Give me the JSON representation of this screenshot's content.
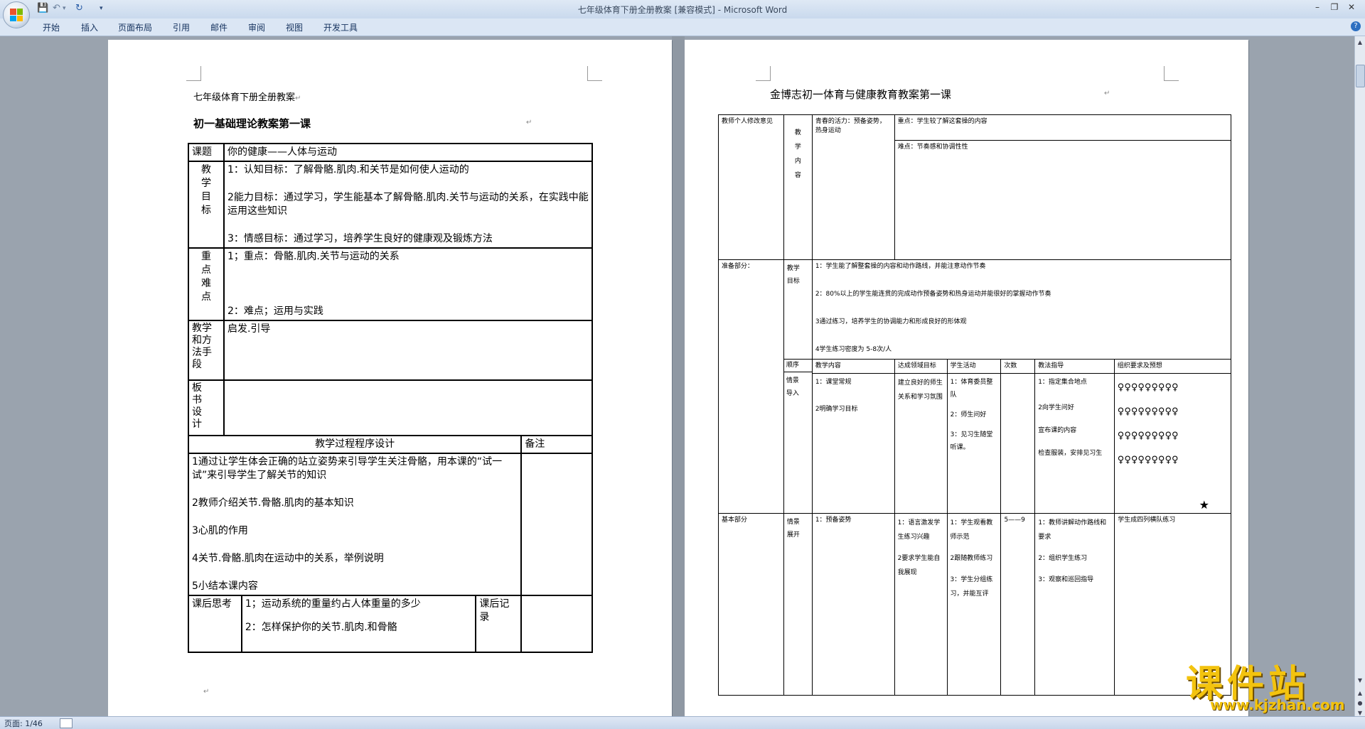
{
  "app": {
    "window_title": "七年级体育下册全册教案 [兼容模式] - Microsoft Word",
    "ribbon_tabs": [
      "开始",
      "插入",
      "页面布局",
      "引用",
      "邮件",
      "审阅",
      "视图",
      "开发工具"
    ],
    "status": {
      "page": "页面: 1/46"
    },
    "help": "?"
  },
  "page1": {
    "header": "七年级体育下册全册教案",
    "title": "初一基础理论教案第一课",
    "table": {
      "topic_label": "课题",
      "topic_value": "你的健康——人体与运动",
      "goals_label": "教学目标",
      "goals": [
        "1：认知目标：了解骨骼.肌肉.和关节是如何使人运动的",
        "2能力目标：通过学习，学生能基本了解骨骼.肌肉.关节与运动的关系，在实践中能运用这些知识",
        "3：情感目标：通过学习，培养学生良好的健康观及锻炼方法"
      ],
      "key_label": "重点难点",
      "key_points": [
        "1；重点：骨骼.肌肉.关节与运动的关系",
        "2：难点；运用与实践"
      ],
      "method_label": "教学和方法手段",
      "method_value": "启发.引导",
      "board_label": "板书设计",
      "process_header": "教学过程程序设计",
      "remark_header": "备注",
      "process_items": [
        "1通过让学生体会正确的站立姿势来引导学生关注骨骼，用本课的“试一试”来引导学生了解关节的知识",
        "2教师介绍关节.骨骼.肌肉的基本知识",
        "3心肌的作用",
        "4关节.骨骼.肌肉在运动中的关系，举例说明",
        "5小结本课内容"
      ],
      "after_label": "课后思考",
      "after_items": [
        "1；运动系统的重量约占人体重量的多少",
        "2：怎样保护你的关节.肌肉.和骨骼"
      ],
      "record_label": "课后记录"
    }
  },
  "page2": {
    "title": "金博志初一体育与健康教育教案第一课",
    "row1": {
      "col1": "教师个人修改意见",
      "col2": "教学内容",
      "col3": "青春的活力：预备姿势，热身运动",
      "key": "重点：学生较了解这套操的内容",
      "difficulty": "难点：节奏感和协调性性"
    },
    "row2": {
      "col1": "准备部分：",
      "goal_label": "教学目标",
      "goals": [
        "1：学生能了解整套操的内容和动作路线，并能注意动作节奏",
        "2：80%以上的学生能连贯的完成动作预备姿势和热身运动并能很好的掌握动作节奏",
        "3通过练习，培养学生的协调能力和形成良好的形体观",
        "4学生练习密度为    5-8次/人"
      ]
    },
    "row3": {
      "headers": [
        "顺序",
        "教学内容",
        "达成领域目标",
        "学生活动",
        "次数",
        "教法指导",
        "组织要求及预想"
      ],
      "order": "情景导入",
      "content": [
        "1：课堂常规",
        "2明确学习目标"
      ],
      "target": "建立良好的师生关系和学习氛围",
      "activities": [
        "1：体育委员整队",
        "2：师生问好",
        "3：见习生随堂听课。"
      ],
      "guidance": [
        "1：指定集合地点",
        "2向学生问好",
        "宣布课的内容",
        "检查服装，安排见习生"
      ],
      "formation_rows": [
        "♀♀♀♀♀♀♀♀♀",
        "♀♀♀♀♀♀♀♀♀",
        "♀♀♀♀♀♀♀♀♀",
        "♀♀♀♀♀♀♀♀♀"
      ],
      "star": "★"
    },
    "row4": {
      "col1": "基本部分",
      "order": "情景展开",
      "content": "1：预备姿势",
      "target": [
        "1：语言激发学生练习兴趣",
        "2要求学生能自我展现"
      ],
      "activities": [
        "1：学生观看教师示范",
        "2跟随教师练习",
        "3：学生分组练习，并能互评"
      ],
      "count": "5——9",
      "guidance": [
        "1：教师讲解动作路线和要求",
        "2：组织学生练习",
        "3：观察和巡回指导"
      ],
      "formation": "学生成四列横队练习"
    }
  },
  "watermark": {
    "text": "课件站",
    "url": "www.kjzhan.com"
  }
}
